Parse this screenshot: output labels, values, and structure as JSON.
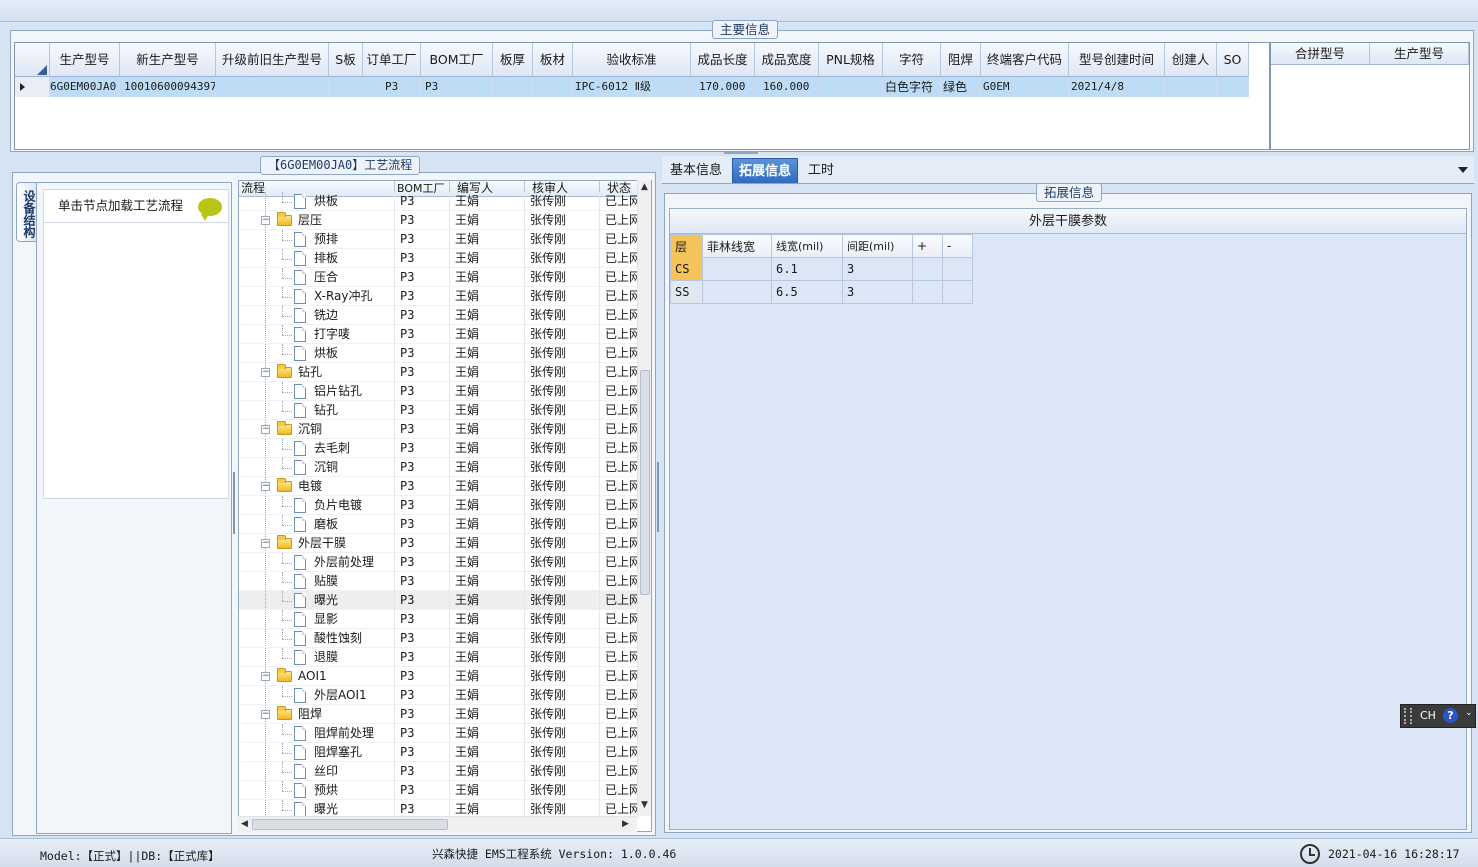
{
  "main_info": {
    "title": "主要信息",
    "columns": [
      "生产型号",
      "新生产型号",
      "升级前旧生产型号",
      "S板",
      "订单工厂",
      "BOM工厂",
      "板厚",
      "板材",
      "验收标准",
      "成品长度",
      "成品宽度",
      "PNL规格",
      "字符",
      "阻焊",
      "终端客户代码",
      "型号创建时间",
      "创建人",
      "SO"
    ],
    "row": [
      "6G0EM00JA0",
      "10010600094397",
      "",
      "",
      "P3",
      "P3",
      "",
      "",
      "IPC-6012 Ⅱ级",
      "170.000",
      "160.000",
      "",
      "白色字符",
      "绿色",
      "G0EM",
      "2021/4/8",
      "",
      ""
    ],
    "merge_columns": [
      "合拼型号",
      "生产型号"
    ]
  },
  "process": {
    "title": "【6G0EM00JA0】工艺流程",
    "side_tab": "设备结构",
    "load_hint": "单击节点加载工艺流程",
    "columns": [
      "流程",
      "BOM工厂",
      "编写人",
      "核审人",
      "状态"
    ],
    "rows": [
      {
        "name": "烘板",
        "lvl": 2,
        "type": "doc",
        "bom": "P3",
        "writer": "王娟",
        "reviewer": "张传刚",
        "status": "已上网"
      },
      {
        "name": "层压",
        "lvl": 1,
        "type": "folder",
        "bom": "P3",
        "writer": "王娟",
        "reviewer": "张传刚",
        "status": "已上网"
      },
      {
        "name": "预排",
        "lvl": 2,
        "type": "doc",
        "bom": "P3",
        "writer": "王娟",
        "reviewer": "张传刚",
        "status": "已上网"
      },
      {
        "name": "排板",
        "lvl": 2,
        "type": "doc",
        "bom": "P3",
        "writer": "王娟",
        "reviewer": "张传刚",
        "status": "已上网"
      },
      {
        "name": "压合",
        "lvl": 2,
        "type": "doc",
        "bom": "P3",
        "writer": "王娟",
        "reviewer": "张传刚",
        "status": "已上网"
      },
      {
        "name": "X-Ray冲孔",
        "lvl": 2,
        "type": "doc",
        "bom": "P3",
        "writer": "王娟",
        "reviewer": "张传刚",
        "status": "已上网"
      },
      {
        "name": "铣边",
        "lvl": 2,
        "type": "doc",
        "bom": "P3",
        "writer": "王娟",
        "reviewer": "张传刚",
        "status": "已上网"
      },
      {
        "name": "打字唛",
        "lvl": 2,
        "type": "doc",
        "bom": "P3",
        "writer": "王娟",
        "reviewer": "张传刚",
        "status": "已上网"
      },
      {
        "name": "烘板",
        "lvl": 2,
        "type": "doc",
        "bom": "P3",
        "writer": "王娟",
        "reviewer": "张传刚",
        "status": "已上网"
      },
      {
        "name": "钻孔",
        "lvl": 1,
        "type": "folder",
        "bom": "P3",
        "writer": "王娟",
        "reviewer": "张传刚",
        "status": "已上网"
      },
      {
        "name": "铝片钻孔",
        "lvl": 2,
        "type": "doc",
        "bom": "P3",
        "writer": "王娟",
        "reviewer": "张传刚",
        "status": "已上网"
      },
      {
        "name": "钻孔",
        "lvl": 2,
        "type": "doc",
        "bom": "P3",
        "writer": "王娟",
        "reviewer": "张传刚",
        "status": "已上网"
      },
      {
        "name": "沉铜",
        "lvl": 1,
        "type": "folder",
        "bom": "P3",
        "writer": "王娟",
        "reviewer": "张传刚",
        "status": "已上网"
      },
      {
        "name": "去毛刺",
        "lvl": 2,
        "type": "doc",
        "bom": "P3",
        "writer": "王娟",
        "reviewer": "张传刚",
        "status": "已上网"
      },
      {
        "name": "沉铜",
        "lvl": 2,
        "type": "doc",
        "bom": "P3",
        "writer": "王娟",
        "reviewer": "张传刚",
        "status": "已上网"
      },
      {
        "name": "电镀",
        "lvl": 1,
        "type": "folder",
        "bom": "P3",
        "writer": "王娟",
        "reviewer": "张传刚",
        "status": "已上网"
      },
      {
        "name": "负片电镀",
        "lvl": 2,
        "type": "doc",
        "bom": "P3",
        "writer": "王娟",
        "reviewer": "张传刚",
        "status": "已上网"
      },
      {
        "name": "磨板",
        "lvl": 2,
        "type": "doc",
        "bom": "P3",
        "writer": "王娟",
        "reviewer": "张传刚",
        "status": "已上网"
      },
      {
        "name": "外层干膜",
        "lvl": 1,
        "type": "folder",
        "bom": "P3",
        "writer": "王娟",
        "reviewer": "张传刚",
        "status": "已上网"
      },
      {
        "name": "外层前处理",
        "lvl": 2,
        "type": "doc",
        "bom": "P3",
        "writer": "王娟",
        "reviewer": "张传刚",
        "status": "已上网"
      },
      {
        "name": "贴膜",
        "lvl": 2,
        "type": "doc",
        "bom": "P3",
        "writer": "王娟",
        "reviewer": "张传刚",
        "status": "已上网"
      },
      {
        "name": "曝光",
        "lvl": 2,
        "type": "doc",
        "bom": "P3",
        "writer": "王娟",
        "reviewer": "张传刚",
        "status": "已上网",
        "selected": true
      },
      {
        "name": "显影",
        "lvl": 2,
        "type": "doc",
        "bom": "P3",
        "writer": "王娟",
        "reviewer": "张传刚",
        "status": "已上网"
      },
      {
        "name": "酸性蚀刻",
        "lvl": 2,
        "type": "doc",
        "bom": "P3",
        "writer": "王娟",
        "reviewer": "张传刚",
        "status": "已上网"
      },
      {
        "name": "退膜",
        "lvl": 2,
        "type": "doc",
        "bom": "P3",
        "writer": "王娟",
        "reviewer": "张传刚",
        "status": "已上网"
      },
      {
        "name": "AOI1",
        "lvl": 1,
        "type": "folder",
        "bom": "P3",
        "writer": "王娟",
        "reviewer": "张传刚",
        "status": "已上网"
      },
      {
        "name": "外层AOI1",
        "lvl": 2,
        "type": "doc",
        "bom": "P3",
        "writer": "王娟",
        "reviewer": "张传刚",
        "status": "已上网"
      },
      {
        "name": "阻焊",
        "lvl": 1,
        "type": "folder",
        "bom": "P3",
        "writer": "王娟",
        "reviewer": "张传刚",
        "status": "已上网"
      },
      {
        "name": "阻焊前处理",
        "lvl": 2,
        "type": "doc",
        "bom": "P3",
        "writer": "王娟",
        "reviewer": "张传刚",
        "status": "已上网"
      },
      {
        "name": "阻焊塞孔",
        "lvl": 2,
        "type": "doc",
        "bom": "P3",
        "writer": "王娟",
        "reviewer": "张传刚",
        "status": "已上网"
      },
      {
        "name": "丝印",
        "lvl": 2,
        "type": "doc",
        "bom": "P3",
        "writer": "王娟",
        "reviewer": "张传刚",
        "status": "已上网"
      },
      {
        "name": "预烘",
        "lvl": 2,
        "type": "doc",
        "bom": "P3",
        "writer": "王娟",
        "reviewer": "张传刚",
        "status": "已上网"
      },
      {
        "name": "曝光",
        "lvl": 2,
        "type": "doc",
        "bom": "P3",
        "writer": "王娟",
        "reviewer": "张传刚",
        "status": "已上网"
      }
    ]
  },
  "tabs": {
    "basic": "基本信息",
    "extended": "拓展信息",
    "hours": "工时",
    "active": "拓展信息"
  },
  "extended": {
    "group_title": "拓展信息",
    "table_title": "外层干膜参数",
    "headers": [
      "层",
      "菲林线宽",
      "线宽(mil)",
      "间距(mil)",
      "+",
      "-"
    ],
    "rows": [
      [
        "CS",
        "",
        "6.1",
        "3",
        "",
        ""
      ],
      [
        "SS",
        "",
        "6.5",
        "3",
        "",
        ""
      ]
    ]
  },
  "status_bar": {
    "model_db": "Model:【正式】||DB:【正式库】",
    "app": "兴森快捷 EMS工程系统 Version: 1.0.0.46",
    "datetime": "2021-04-16 16:28:17"
  },
  "ime": {
    "label": "CH"
  },
  "colors": {
    "selected_row": "#bfdcf6",
    "active_tab": "#3a78c9",
    "layer_highlight": "#f6c35b"
  }
}
